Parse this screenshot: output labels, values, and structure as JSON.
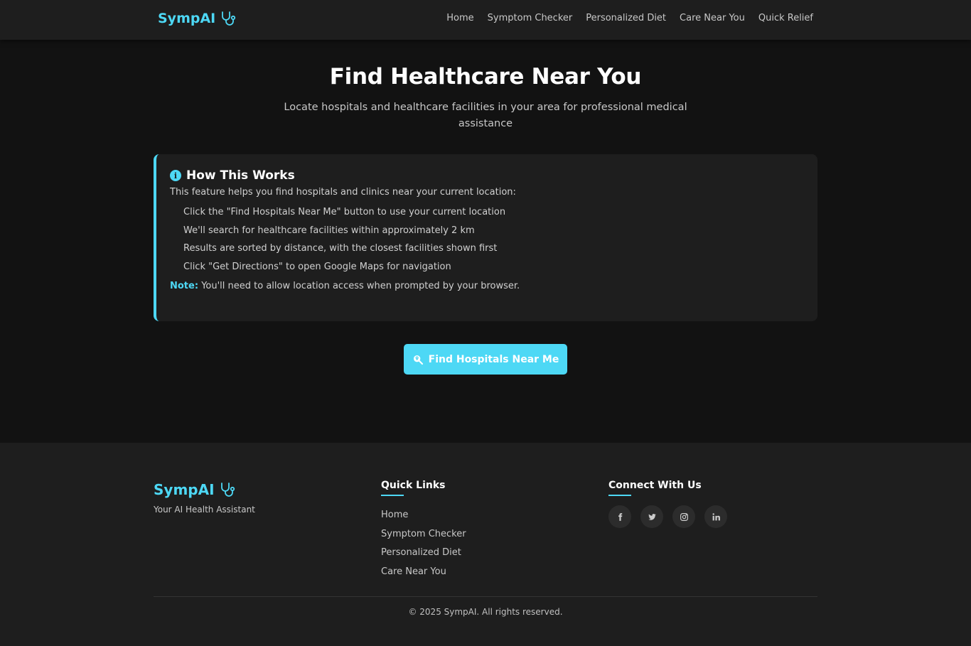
{
  "brand": {
    "name": "SympAI",
    "icon": "stethoscope-icon"
  },
  "nav": {
    "links": [
      "Home",
      "Symptom Checker",
      "Personalized Diet",
      "Care Near You",
      "Quick Relief"
    ]
  },
  "hero": {
    "title": "Find Healthcare Near You",
    "subtitle": "Locate hospitals and healthcare facilities in your area for professional medical assistance"
  },
  "info": {
    "icon": "info-icon",
    "title": "How This Works",
    "intro": "This feature helps you find hospitals and clinics near your current location:",
    "steps": [
      "Click the \"Find Hospitals Near Me\" button to use your current location",
      "We'll search for healthcare facilities within approximately 2 km",
      "Results are sorted by distance, with the closest facilities shown first",
      "Click \"Get Directions\" to open Google Maps for navigation"
    ],
    "note_label": "Note:",
    "note_text": "You'll need to allow location access when prompted by your browser."
  },
  "action": {
    "find_label": "Find Hospitals Near Me",
    "icon": "search-location-icon"
  },
  "footer": {
    "brand": "SympAI",
    "tagline": "Your AI Health Assistant",
    "quick_links_title": "Quick Links",
    "quick_links": [
      "Home",
      "Symptom Checker",
      "Personalized Diet",
      "Care Near You"
    ],
    "connect_title": "Connect With Us",
    "socials": [
      "facebook-icon",
      "twitter-icon",
      "instagram-icon",
      "linkedin-icon"
    ],
    "copyright": "© 2025 SympAI. All rights reserved."
  },
  "colors": {
    "accent": "#4dd8f5",
    "background": "#121212",
    "surface": "#1e1e1e"
  }
}
